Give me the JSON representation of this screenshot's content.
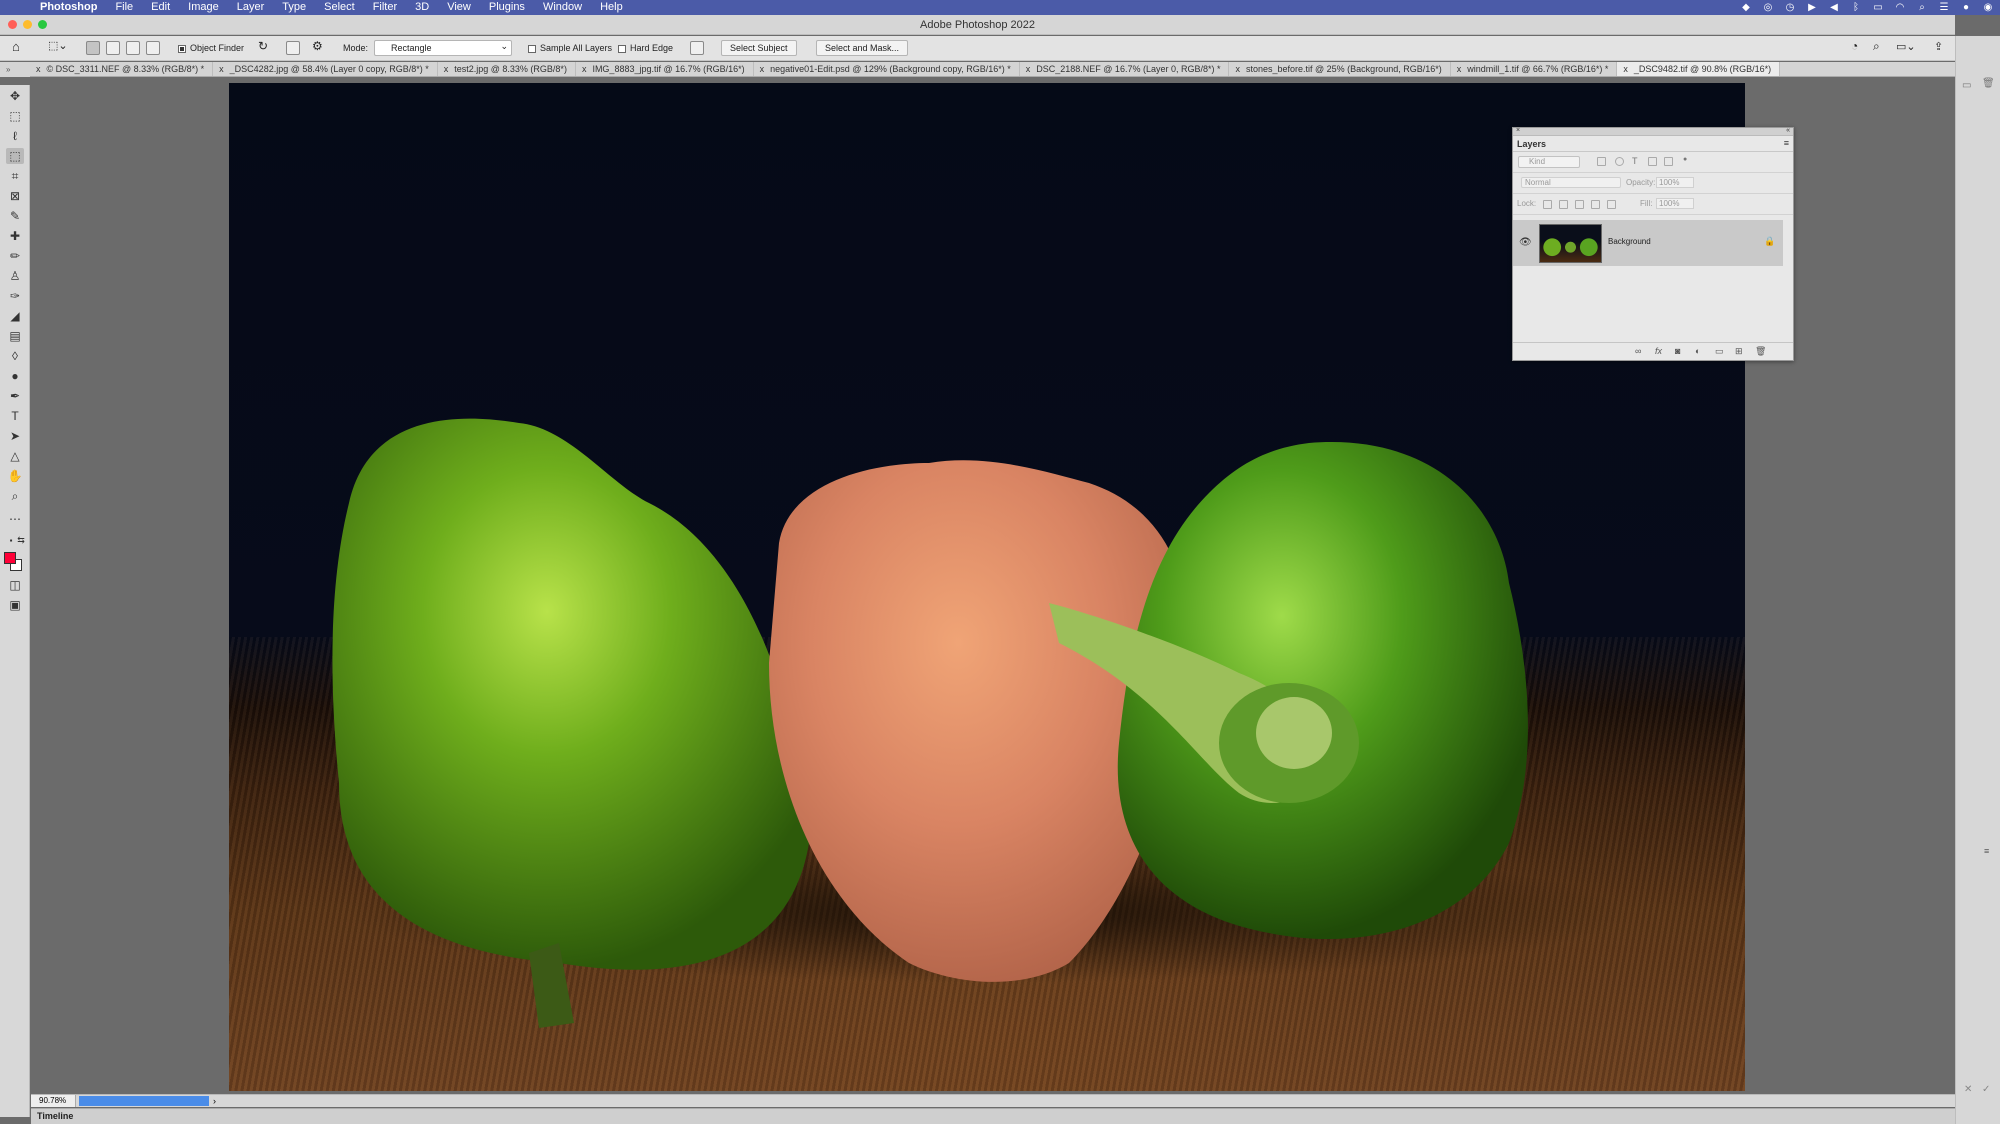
{
  "menubar": {
    "apple": "",
    "app": "Photoshop",
    "items": [
      "File",
      "Edit",
      "Image",
      "Layer",
      "Type",
      "Select",
      "Filter",
      "3D",
      "View",
      "Plugins",
      "Window",
      "Help"
    ]
  },
  "window": {
    "title": "Adobe Photoshop 2022"
  },
  "options": {
    "object_finder_label": "Object Finder",
    "object_finder_checked": true,
    "mode_label": "Mode:",
    "mode_value": "Rectangle",
    "sample_all_layers_label": "Sample All Layers",
    "hard_edge_label": "Hard Edge",
    "select_subject": "Select Subject",
    "select_and_mask": "Select and Mask..."
  },
  "tabs": [
    "© DSC_3311.NEF @ 8.33% (RGB/8*) *",
    "_DSC4282.jpg @ 58.4% (Layer 0 copy, RGB/8*) *",
    "test2.jpg @ 8.33% (RGB/8*)",
    "IMG_8883_jpg.tif @ 16.7% (RGB/16*)",
    "negative01-Edit.psd @ 129% (Background copy, RGB/16*) *",
    "DSC_2188.NEF @ 16.7% (Layer 0, RGB/8*) *",
    "stones_before.tif @ 25% (Background, RGB/16*)",
    "windmill_1.tif @ 66.7% (RGB/16*) *",
    "_DSC9482.tif @ 90.8% (RGB/16*)"
  ],
  "colors": {
    "foreground": "#ff0037",
    "background": "#ffffff",
    "accent": "#4a8ce8",
    "menubar": "#4b5ba8"
  },
  "layers_panel": {
    "title": "Layers",
    "kind_placeholder": "Kind",
    "blend_mode": "Normal",
    "opacity_label": "Opacity:",
    "opacity_value": "100%",
    "lock_label": "Lock:",
    "fill_label": "Fill:",
    "fill_value": "100%",
    "layers": [
      {
        "name": "Background",
        "visible": true,
        "locked": true
      }
    ]
  },
  "status": {
    "zoom": "90.78%",
    "timeline": "Timeline"
  },
  "tools": [
    "move-tool",
    "marquee-tool",
    "lasso-tool",
    "object-selection-tool",
    "crop-tool",
    "frame-tool",
    "eyedropper-tool",
    "healing-brush-tool",
    "brush-tool",
    "clone-stamp-tool",
    "history-brush-tool",
    "eraser-tool",
    "gradient-tool",
    "blur-tool",
    "dodge-tool",
    "pen-tool",
    "type-tool",
    "path-selection-tool",
    "shape-tool",
    "hand-tool",
    "zoom-tool",
    "more-tools"
  ]
}
